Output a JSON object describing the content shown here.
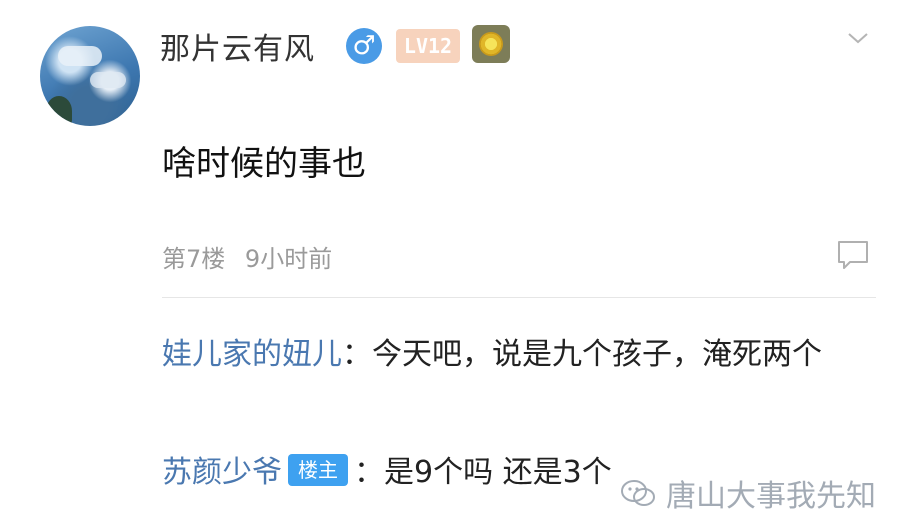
{
  "post": {
    "username": "那片云有风",
    "gender_icon": "male-icon",
    "gender_symbol": "♂",
    "level_badge": "LV12",
    "medal_icon": "medal-icon",
    "comment": "啥时候的事也",
    "floor": "第7楼",
    "time": "9小时前"
  },
  "replies": [
    {
      "user": "娃儿家的妞儿",
      "separator": "：",
      "text": "今天吧，说是九个孩子，淹死两个"
    },
    {
      "user": "苏颜少爷",
      "badge": "楼主",
      "separator": "：",
      "text": "是9个吗 还是3个"
    }
  ],
  "watermark": {
    "text": "唐山大事我先知",
    "icon": "wechat-icon"
  },
  "colors": {
    "reply_user": "#4a78b0",
    "owner_badge": "#3ea1f0",
    "gender_icon": "#4a9be6",
    "meta": "#9a9a9a"
  }
}
